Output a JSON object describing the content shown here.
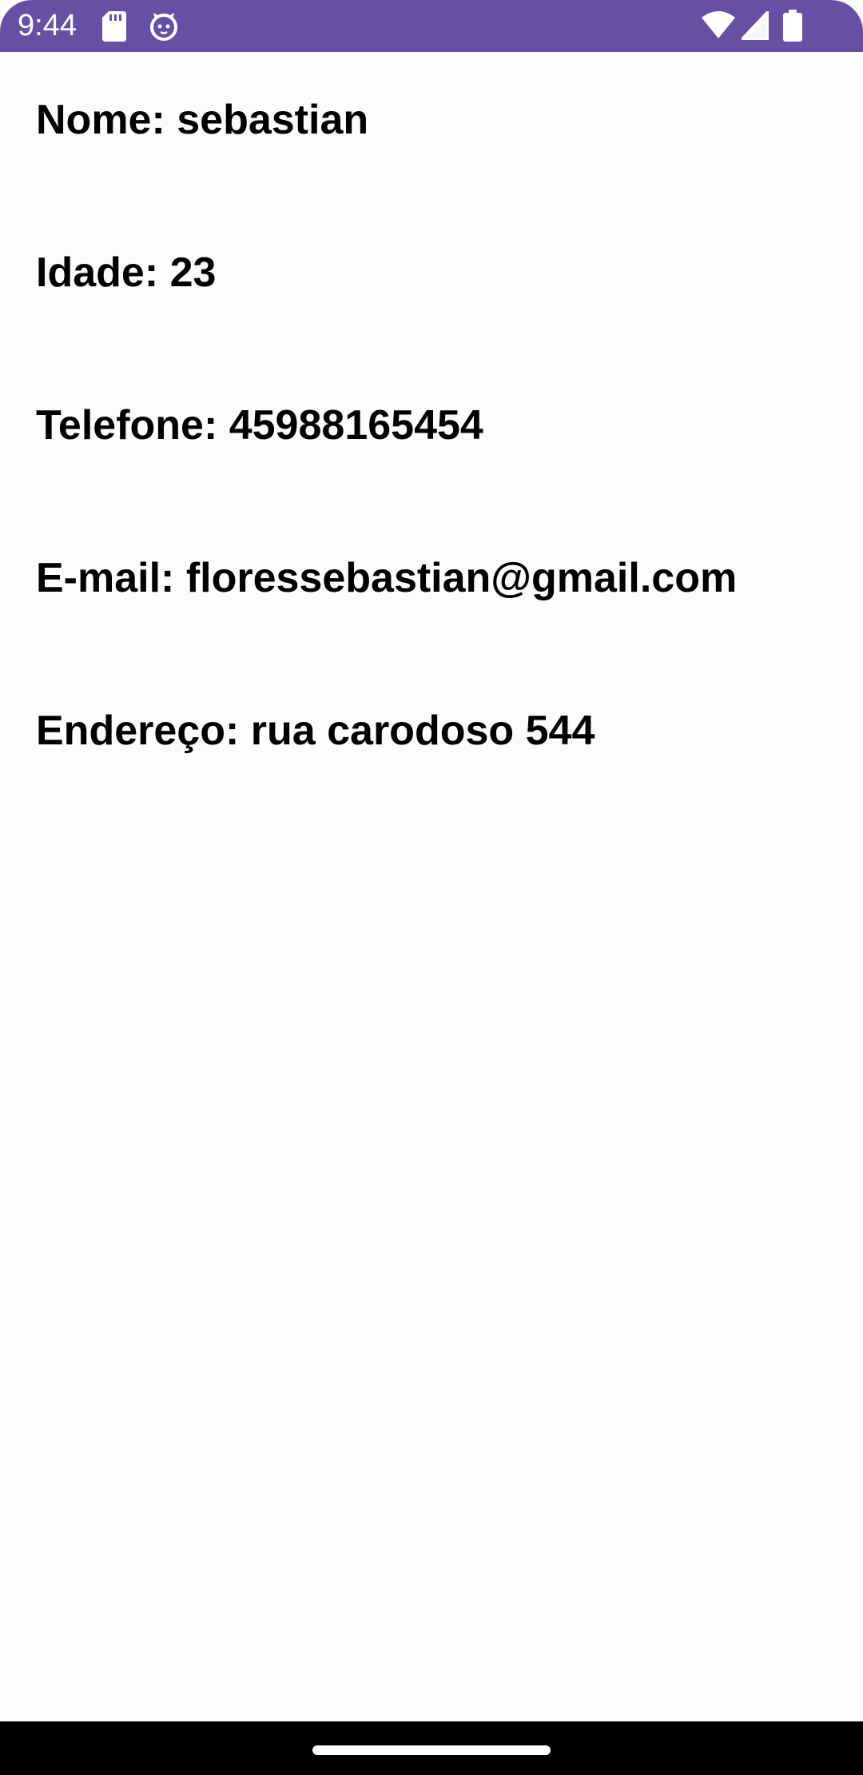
{
  "status_bar": {
    "time": "9:44",
    "background_color": "#6750a4",
    "left_icons": [
      "sd-card-icon",
      "cat-notification-icon"
    ],
    "right_icons": [
      "wifi-icon",
      "signal-icon",
      "battery-icon"
    ]
  },
  "profile": {
    "nome": "Nome: sebastian",
    "idade": "Idade: 23",
    "telefone": "Telefone: 45988165454",
    "email": "E-mail: floressebastian@gmail.com",
    "endereco": "Endereço: rua carodoso 544"
  },
  "theme": {
    "page_background": "#fefbfe",
    "text_color": "#000000",
    "nav_bar_color": "#000000"
  }
}
